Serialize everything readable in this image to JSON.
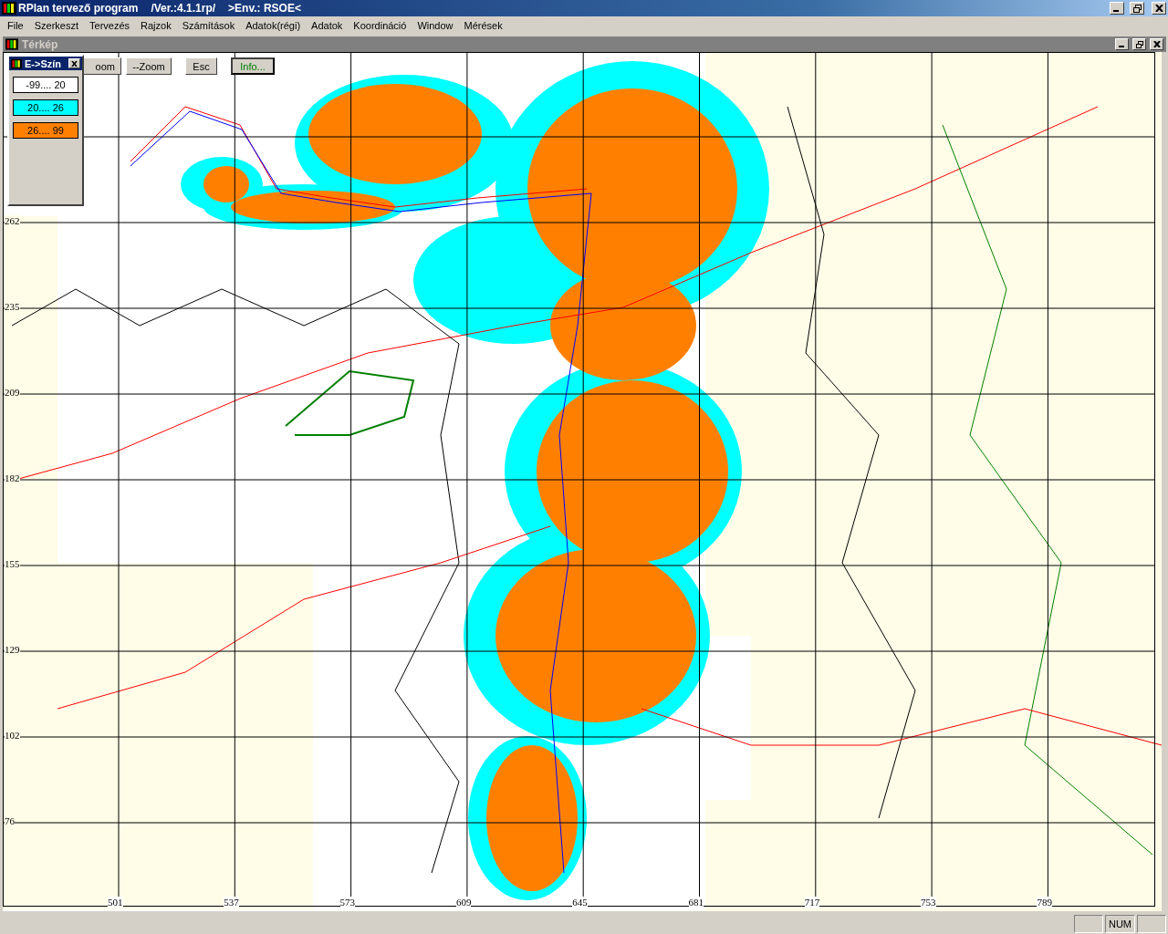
{
  "window": {
    "title": "RPlan tervező program",
    "version": "/Ver.:4.1.1rp/",
    "env": ">Env.: RSOE<"
  },
  "menu": [
    "File",
    "Szerkeszt",
    "Tervezés",
    "Rajzok",
    "Számítások",
    "Adatok(régi)",
    "Adatok",
    "Koordináció",
    "Window",
    "Mérések"
  ],
  "child_window": {
    "title": "Térkép"
  },
  "toolbar": [
    {
      "label": "oom",
      "focused": false
    },
    {
      "label": "--Zoom",
      "focused": false
    },
    {
      "label": "Esc",
      "focused": false
    },
    {
      "label": "Info...",
      "focused": true
    }
  ],
  "legend": {
    "title": "E->Szín",
    "ranges": [
      {
        "label": "-99.... 20",
        "color": "#ffffff"
      },
      {
        "label": "20.... 26",
        "color": "#00ffff"
      },
      {
        "label": "26.... 99",
        "color": "#ff8000"
      }
    ]
  },
  "map": {
    "y_ticks": [
      "262",
      "235",
      "209",
      "182",
      "155",
      "129",
      "102",
      "76"
    ],
    "x_ticks": [
      "501",
      "537",
      "573",
      "609",
      "645",
      "681",
      "717",
      "753",
      "789"
    ]
  },
  "status_bar": {
    "indicators": [
      "NUM"
    ]
  }
}
